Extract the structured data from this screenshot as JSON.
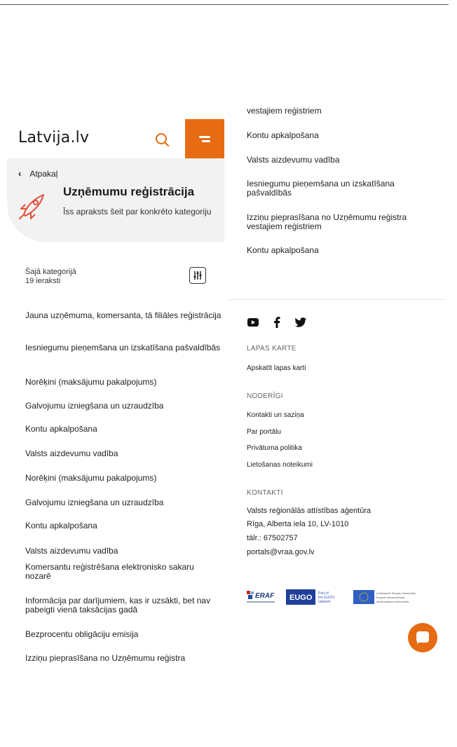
{
  "header": {
    "logo_text": "Latvija.lv",
    "search_icon": "search-icon",
    "menu_icon": "menu-icon",
    "accent": "#e66b12"
  },
  "hero": {
    "back_label": "Atpakaļ",
    "title": "Uzņēmumu reģistrācija",
    "description": "Īss apraksts šeit par konkrēto kategoriju",
    "icon": "rocket-icon"
  },
  "category": {
    "label": "Šajā kategorijā",
    "count": "19 ieraksti",
    "filter_icon": "filter-icon"
  },
  "left_items": [
    "Jauna uzņēmuma, komersanta, tā filiāles reģistrācija",
    "Iesniegumu pieņemšana un izskatīšana pašvaldībās",
    "Norēķini (maksājumu pakalpojums)",
    "Galvojumu izniegšana un uzraudzība",
    "Kontu apkalpošana",
    "Valsts aizdevumu vadība",
    "Norēķini (maksājumu pakalpojums)",
    "Galvojumu izniegšana un uzraudzība",
    "Kontu apkalpošana",
    "Valsts aizdevumu vadība",
    "Komersantu reģistrēšana elektronisko sakaru nozarē",
    "Informācija par darījumiem, kas ir uzsākti, bet nav pabeigti vienā taksācijas gadā",
    "Bezprocentu obligāciju emisija",
    "Izziņu pieprasīšana no Uzņēmumu reģistra"
  ],
  "right_items": [
    "vestajiem reģistriem",
    "Kontu apkalpošana",
    "Valsts aizdevumu vadība",
    "Iesniegumu pieņemšana un izskatīšana pašvaldībās",
    "Izziņu pieprasīšana no Uzņēmumu reģistra vestajiem reģistriem",
    "Kontu apkalpošana"
  ],
  "footer": {
    "social": [
      "youtube-icon",
      "facebook-icon",
      "twitter-icon"
    ],
    "sitemap_heading": "LAPAS KARTE",
    "sitemap_link": "Apskatīt lapas karti",
    "useful_heading": "NODERĪGI",
    "useful_links": [
      "Kontakti un saziņa",
      "Par portālu",
      "Privātuma politika",
      "Lietošanas noteikumi"
    ],
    "contacts_heading": "KONTAKTI",
    "org": "Valsts reģionālās attīstības aģentūra",
    "address": "Rīga, Alberta iela 10, LV-1010",
    "phone": "tālr.: 67502757",
    "email": "portals@vraa.gov.lv",
    "logos": {
      "erb": "ERAF",
      "eugo_badge": "EUGO",
      "eugo_caption": "Part of the EUGO network",
      "eu_caption": "Līdzfinansē Eiropas Savienības Eiropas Infrastruktūras savienošanas instruments"
    }
  },
  "chat_icon": "chat-icon"
}
